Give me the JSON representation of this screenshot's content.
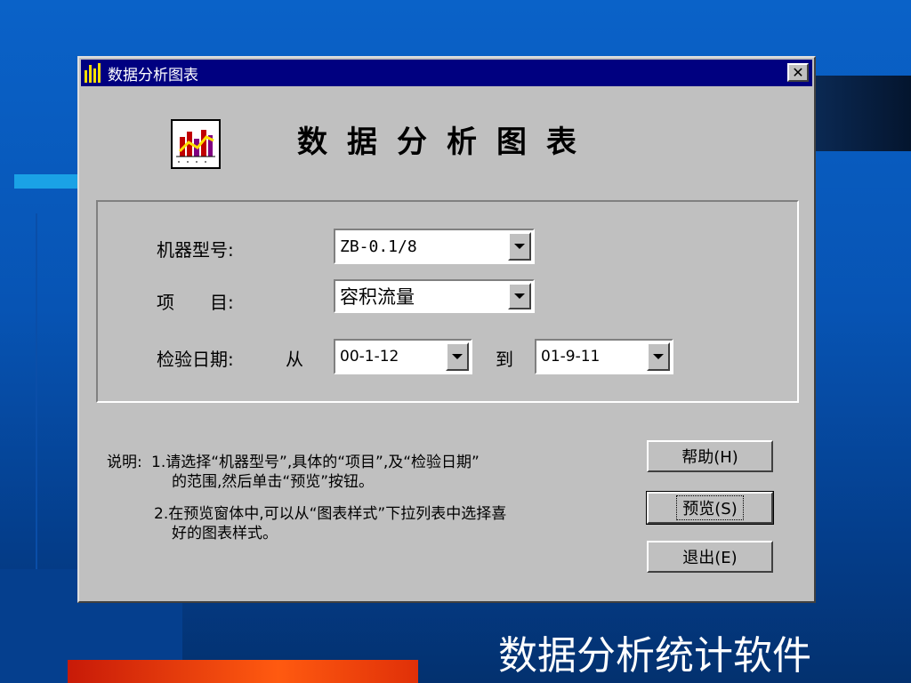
{
  "window": {
    "title": "数据分析图表",
    "close_label": "✕"
  },
  "heading": {
    "text": "数据分析图表",
    "icon": "bar-line-chart-icon"
  },
  "form": {
    "machine_model": {
      "label": "机器型号:",
      "value": "ZB-0.1/8"
    },
    "item": {
      "label": "项　　目:",
      "value": "容积流量"
    },
    "inspection_date": {
      "label": "检验日期:",
      "from_label": "从",
      "from_value": "00-1-12",
      "to_label": "到",
      "to_value": "01-9-11"
    }
  },
  "description": {
    "prefix": "说明:",
    "line1": "1.请选择“机器型号”,具体的“项目”,及“检验日期”",
    "line2": "的范围,然后单击“预览”按钮。",
    "line3": "2.在预览窗体中,可以从“图表样式”下拉列表中选择喜",
    "line4": "好的图表样式。"
  },
  "buttons": {
    "help": "帮助(H)",
    "preview": "预览(S)",
    "exit": "退出(E)"
  },
  "slide": {
    "caption": "数据分析统计软件"
  },
  "colors": {
    "titlebar": "#000080",
    "window_face": "#c0c0c0",
    "slide_background": "#0754b4",
    "accent_red": "#ff5a10"
  }
}
